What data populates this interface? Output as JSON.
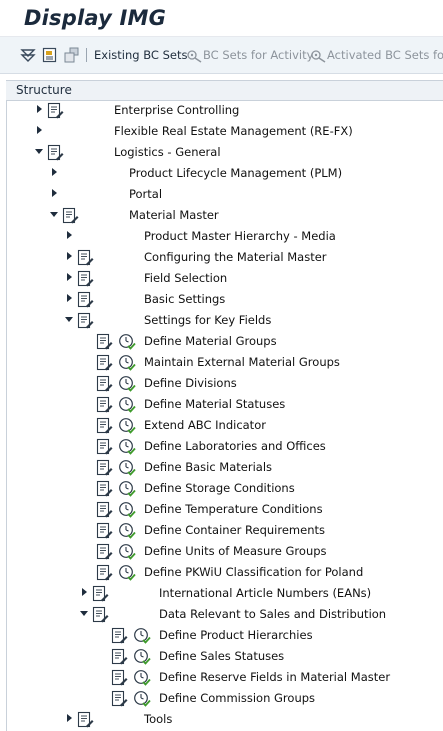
{
  "title": "Display IMG",
  "toolbar": {
    "existing_bc_sets": "Existing BC Sets",
    "bc_sets_for_activity": "BC Sets for Activity",
    "activated_bc_sets": "Activated BC Sets for A"
  },
  "tree": {
    "header": "Structure",
    "rows": [
      {
        "label": "Enterprise Controlling",
        "level": 0,
        "expanded": false
      },
      {
        "label": "Flexible Real Estate Management (RE-FX)",
        "level": 0,
        "expanded": false
      },
      {
        "label": "Logistics - General",
        "level": 0,
        "expanded": true
      },
      {
        "label": "Product Lifecycle Management (PLM)",
        "level": 1,
        "expanded": false
      },
      {
        "label": "Portal",
        "level": 1,
        "expanded": false
      },
      {
        "label": "Material Master",
        "level": 1,
        "expanded": true
      },
      {
        "label": "Product Master Hierarchy - Media",
        "level": 2,
        "expanded": false
      },
      {
        "label": "Configuring the Material Master",
        "level": 2,
        "expanded": false
      },
      {
        "label": "Field Selection",
        "level": 2,
        "expanded": false
      },
      {
        "label": "Basic Settings",
        "level": 2,
        "expanded": false
      },
      {
        "label": "Settings for Key Fields",
        "level": 2,
        "expanded": true
      },
      {
        "label": "Define Material Groups",
        "level": 3
      },
      {
        "label": "Maintain External Material Groups",
        "level": 3
      },
      {
        "label": "Define Divisions",
        "level": 3
      },
      {
        "label": "Define Material Statuses",
        "level": 3
      },
      {
        "label": "Extend ABC Indicator",
        "level": 3
      },
      {
        "label": "Define Laboratories and Offices",
        "level": 3
      },
      {
        "label": "Define Basic Materials",
        "level": 3
      },
      {
        "label": "Define Storage Conditions",
        "level": 3
      },
      {
        "label": "Define Temperature Conditions",
        "level": 3
      },
      {
        "label": "Define Container Requirements",
        "level": 3
      },
      {
        "label": "Define Units of Measure Groups",
        "level": 3
      },
      {
        "label": "Define PKWiU Classification for Poland",
        "level": 3
      },
      {
        "label": "International Article Numbers (EANs)",
        "level": 3,
        "expanded": false
      },
      {
        "label": "Data Relevant to Sales and Distribution",
        "level": 3,
        "expanded": true
      },
      {
        "label": "Define Product Hierarchies",
        "level": 4
      },
      {
        "label": "Define Sales Statuses",
        "level": 4
      },
      {
        "label": "Define Reserve Fields in Material Master",
        "level": 4
      },
      {
        "label": "Define Commission Groups",
        "level": 4
      },
      {
        "label": "Tools",
        "level": 2,
        "expanded": false
      }
    ]
  }
}
